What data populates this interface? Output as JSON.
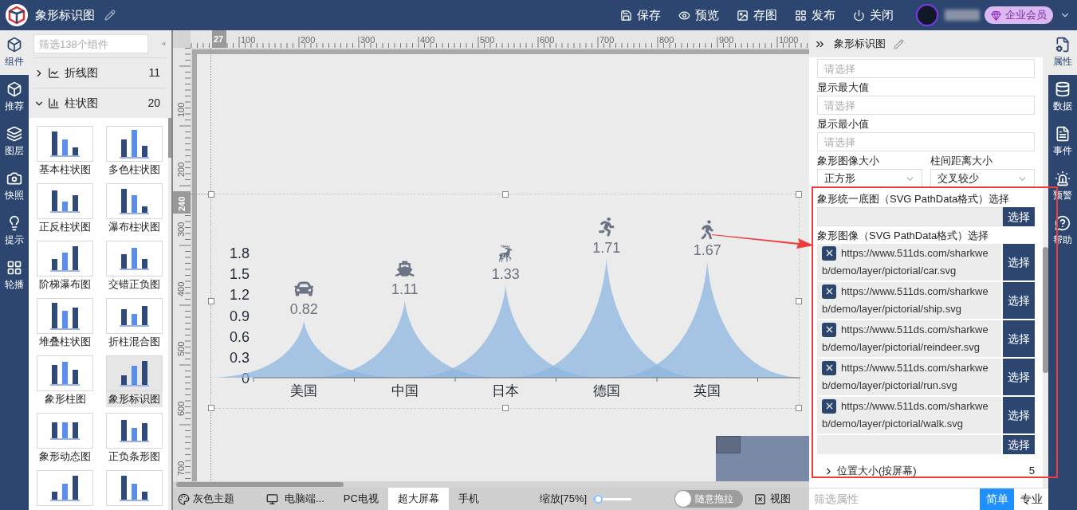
{
  "header": {
    "title": "象形标识图",
    "actions": [
      {
        "label": "保存",
        "kind": "save"
      },
      {
        "label": "预览",
        "kind": "preview"
      },
      {
        "label": "存图",
        "kind": "image"
      },
      {
        "label": "发布",
        "kind": "publish"
      },
      {
        "label": "关闭",
        "kind": "close"
      }
    ],
    "membership": "企业会员"
  },
  "left_rail": [
    {
      "label": "组件",
      "kind": "components",
      "selected": true
    },
    {
      "label": "推荐",
      "kind": "recommend",
      "selected": false
    },
    {
      "label": "图层",
      "kind": "layers",
      "selected": false
    },
    {
      "label": "快照",
      "kind": "snapshot",
      "selected": false
    },
    {
      "label": "提示",
      "kind": "tips",
      "selected": false
    },
    {
      "label": "轮播",
      "kind": "carousel",
      "selected": false
    }
  ],
  "component_panel": {
    "search_placeholder": "筛选138个组件",
    "groups": [
      {
        "label": "折线图",
        "count": "11",
        "kind": "line",
        "expanded": false
      },
      {
        "label": "柱状图",
        "count": "20",
        "kind": "bar",
        "expanded": true
      }
    ],
    "items": [
      {
        "label": "基本柱状图",
        "selected": false
      },
      {
        "label": "多色柱状图",
        "selected": false
      },
      {
        "label": "正反柱状图",
        "selected": false
      },
      {
        "label": "瀑布柱状图",
        "selected": false
      },
      {
        "label": "阶梯瀑布图",
        "selected": false
      },
      {
        "label": "交错正负图",
        "selected": false
      },
      {
        "label": "堆叠柱状图",
        "selected": false
      },
      {
        "label": "折柱混合图",
        "selected": false
      },
      {
        "label": "象形柱图",
        "selected": false
      },
      {
        "label": "象形标识图",
        "selected": true
      },
      {
        "label": "象形动态图",
        "selected": false
      },
      {
        "label": "正负条形图",
        "selected": false
      },
      {
        "selected": false
      },
      {
        "selected": false
      }
    ]
  },
  "rulers": {
    "top_labels": [
      "100",
      "200",
      "300",
      "400",
      "500",
      "600",
      "700",
      "800",
      "900",
      "1000"
    ],
    "left_labels": [
      "100",
      "200",
      "300",
      "400",
      "500",
      "600",
      "700"
    ],
    "x_marker": "27",
    "y_marker": "240"
  },
  "chart": {
    "chart_data": {
      "type": "area",
      "categories": [
        "美国",
        "中国",
        "日本",
        "德国",
        "英国"
      ],
      "values": [
        0.82,
        1.11,
        1.33,
        1.71,
        1.67
      ],
      "yticks": [
        0,
        0.3,
        0.6,
        0.9,
        1.2,
        1.5,
        1.8
      ],
      "ylim": [
        0,
        1.8
      ],
      "data_labels": true
    },
    "value_labels": [
      "0.82",
      "1.11",
      "1.33",
      "1.71",
      "1.67"
    ],
    "symbols": [
      {
        "kind": "car"
      },
      {
        "kind": "ship"
      },
      {
        "kind": "deer"
      },
      {
        "kind": "run"
      },
      {
        "kind": "walk"
      }
    ]
  },
  "bottom_bar": {
    "theme": "灰色主题",
    "devices": [
      {
        "label": "电脑端...",
        "kind": "desktop",
        "selected": false
      },
      {
        "label": "PC电视",
        "kind": "plain",
        "selected": false
      },
      {
        "label": "超大屏幕",
        "kind": "plain",
        "selected": true
      },
      {
        "label": "手机",
        "kind": "plain",
        "selected": false
      }
    ],
    "zoom": {
      "label": "缩放[75%]",
      "level": 0.12
    },
    "drag_toggle": {
      "label": "随意拖拉",
      "on": false
    },
    "view": "视图"
  },
  "right_panel": {
    "title": "象形标识图",
    "fields": [
      {
        "placeholder": "请选择"
      },
      {
        "label": "显示最大值",
        "placeholder": "请选择"
      },
      {
        "label": "显示最小值",
        "placeholder": "请选择"
      }
    ],
    "selects": [
      {
        "label": "象形图像大小",
        "value": "正方形"
      },
      {
        "label": "柱间距离大小",
        "value": "交叉较少"
      }
    ],
    "base_image": {
      "label": "象形统一底图（SVG PathData格式）选择",
      "button": "选择"
    },
    "images": {
      "label": "象形图像（SVG PathData格式）选择",
      "items": [
        {
          "url": "https://www.511ds.com/sharkweb/demo/layer/pictorial/car.svg",
          "button": "选择"
        },
        {
          "url": "https://www.511ds.com/sharkweb/demo/layer/pictorial/ship.svg",
          "button": "选择"
        },
        {
          "url": "https://www.511ds.com/sharkweb/demo/layer/pictorial/reindeer.svg",
          "button": "选择"
        },
        {
          "url": "https://www.511ds.com/sharkweb/demo/layer/pictorial/run.svg",
          "button": "选择"
        },
        {
          "url": "https://www.511ds.com/sharkweb/demo/layer/pictorial/walk.svg",
          "button": "选择"
        }
      ],
      "empty_button": "选择"
    },
    "section": {
      "label": "位置大小(按屏幕)",
      "count": "5",
      "expanded": false
    },
    "filter_placeholder": "筛选属性",
    "modes": [
      {
        "label": "简单",
        "selected": true
      },
      {
        "label": "专业",
        "selected": false
      }
    ]
  },
  "right_rail": [
    {
      "label": "属性",
      "kind": "properties",
      "selected": true
    },
    {
      "label": "数据",
      "kind": "data",
      "selected": false
    },
    {
      "label": "事件",
      "kind": "events",
      "selected": false
    },
    {
      "label": "预警",
      "kind": "alert",
      "selected": false
    },
    {
      "label": "帮助",
      "kind": "help",
      "selected": false
    }
  ]
}
